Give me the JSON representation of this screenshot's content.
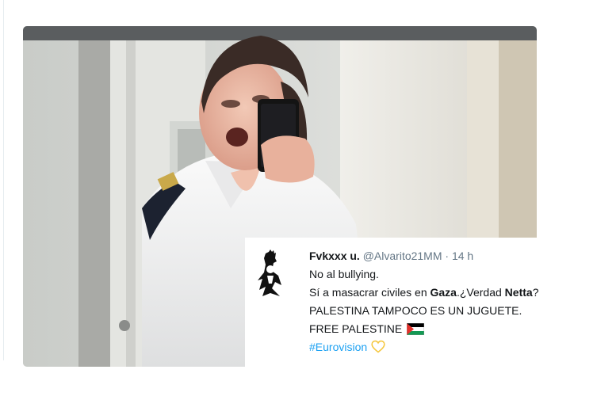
{
  "photo": {
    "alt_subject": "mirror-selfie-photo"
  },
  "tweet": {
    "display_name": "Fvkxxx u.",
    "handle": "@Alvarito21MM",
    "separator": "·",
    "time": "14 h",
    "lines": {
      "line1": "No al bullying.",
      "line2_pre": "Sí a masacrar civiles en ",
      "line2_bold1": "Gaza",
      "line2_mid": ".¿Verdad ",
      "line2_bold2": "Netta",
      "line2_post": "?",
      "line3": "PALESTINA TAMPOCO ES UN JUGUETE.",
      "line4": "FREE PALESTINE",
      "line5_hashtag": "#Eurovision"
    },
    "icons": {
      "flag": "palestine-flag-icon",
      "heart": "yellow-heart-icon"
    }
  },
  "colors": {
    "hashtag": "#1da1f2",
    "muted": "#657786",
    "text": "#14171a",
    "heart": "#f5c842"
  }
}
